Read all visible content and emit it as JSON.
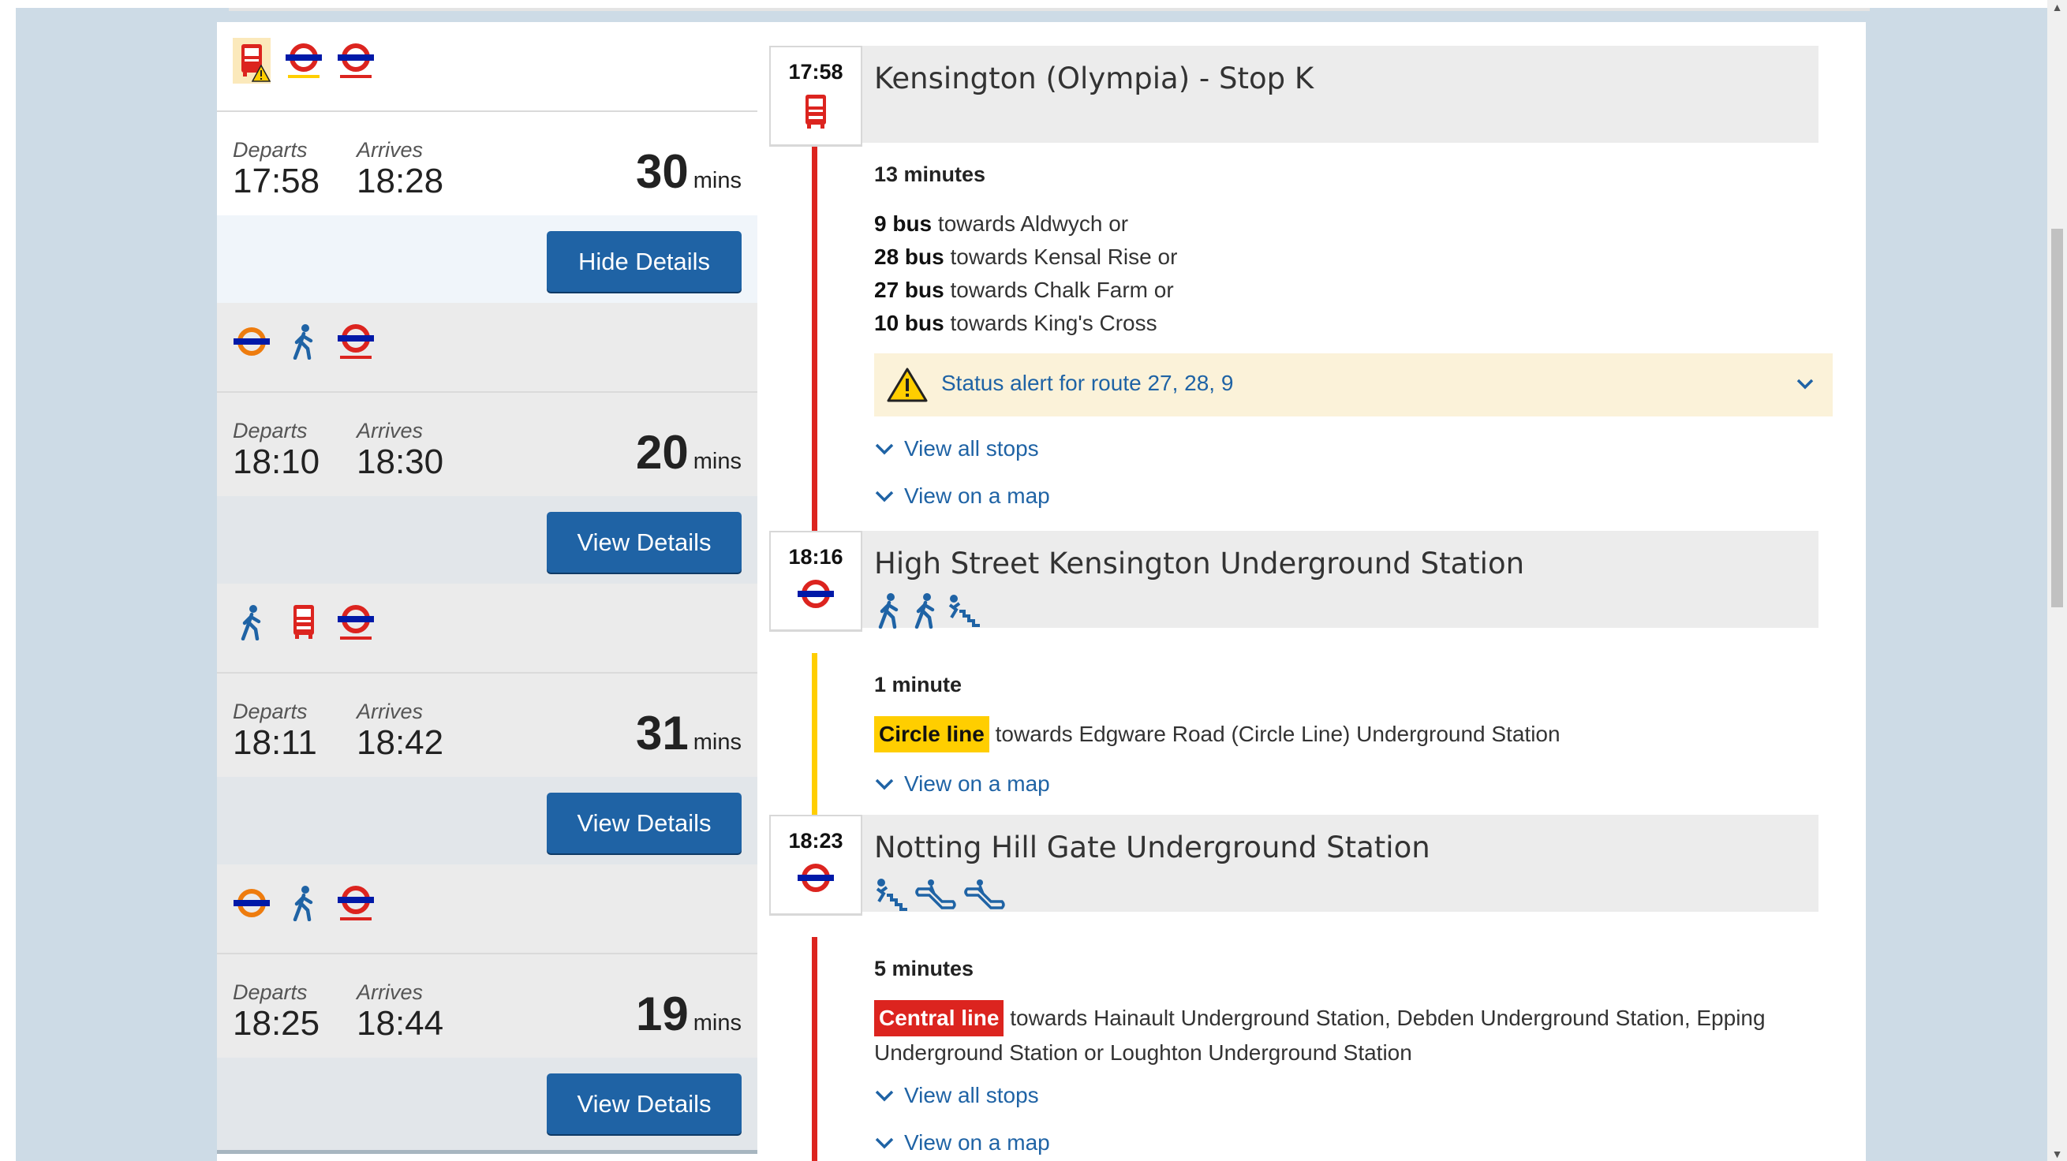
{
  "journeys": [
    {
      "modes": [
        "bus-warning-icon",
        "circle-line-tube-icon",
        "central-line-tube-icon"
      ],
      "departs_label": "Departs",
      "arrives_label": "Arrives",
      "departs": "17:58",
      "arrives": "18:28",
      "duration": "30",
      "unit": "mins",
      "button": "Hide Details",
      "selected": true
    },
    {
      "modes": [
        "overground-icon",
        "walk-icon",
        "central-line-tube-icon"
      ],
      "departs_label": "Departs",
      "arrives_label": "Arrives",
      "departs": "18:10",
      "arrives": "18:30",
      "duration": "20",
      "unit": "mins",
      "button": "View Details",
      "selected": false
    },
    {
      "modes": [
        "walk-icon",
        "bus-icon",
        "central-line-tube-icon"
      ],
      "departs_label": "Departs",
      "arrives_label": "Arrives",
      "departs": "18:11",
      "arrives": "18:42",
      "duration": "31",
      "unit": "mins",
      "button": "View Details",
      "selected": false
    },
    {
      "modes": [
        "overground-icon",
        "walk-icon",
        "central-line-tube-icon"
      ],
      "departs_label": "Departs",
      "arrives_label": "Arrives",
      "departs": "18:25",
      "arrives": "18:44",
      "duration": "19",
      "unit": "mins",
      "button": "View Details",
      "selected": false
    }
  ],
  "details": {
    "stop1": {
      "time": "17:58",
      "name": "Kensington (Olympia) - Stop K",
      "icon": "bus-icon"
    },
    "leg1": {
      "duration": "13 minutes",
      "options": [
        {
          "route": "9 bus",
          "towards": "towards Aldwych or"
        },
        {
          "route": "28 bus",
          "towards": "towards Kensal Rise or"
        },
        {
          "route": "27 bus",
          "towards": "towards Chalk Farm or"
        },
        {
          "route": "10 bus",
          "towards": "towards King's Cross"
        }
      ],
      "alert": "Status alert for route 27, 28, 9",
      "view_all_stops": "View all stops",
      "view_map": "View on a map"
    },
    "stop2": {
      "time": "18:16",
      "name": "High Street Kensington Underground Station",
      "icon": "underground-icon",
      "facilities": [
        "walk-icon",
        "walk-icon",
        "stairs-icon"
      ]
    },
    "leg2": {
      "duration": "1 minute",
      "line": "Circle line",
      "towards": "towards Edgware Road (Circle Line) Underground Station",
      "view_map": "View on a map"
    },
    "stop3": {
      "time": "18:23",
      "name": "Notting Hill Gate Underground Station",
      "icon": "underground-icon",
      "facilities": [
        "stairs-icon",
        "escalator-icon",
        "escalator-icon"
      ]
    },
    "leg3": {
      "duration": "5 minutes",
      "line": "Central line",
      "towards_1": "towards Hainault Underground Station, Debden Underground Station, Epping",
      "towards_2": "Underground Station or Loughton Underground Station",
      "view_all_stops": "View all stops",
      "view_map": "View on a map"
    }
  },
  "colors": {
    "tfl_blue": "#1f63a5",
    "circle": "#ffce00",
    "central": "#dc241f",
    "bus": "#dc241f",
    "overground": "#ee7c0e"
  }
}
